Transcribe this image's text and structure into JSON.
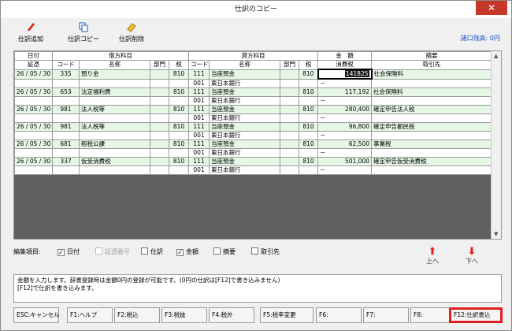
{
  "window": {
    "title": "仕訳のコピー",
    "close_glyph": "✕"
  },
  "toolbar": {
    "add_label": "仕訳追加",
    "copy_label": "仕訳コピー",
    "delete_label": "仕訳削除",
    "balance": "諸口残高: 0円"
  },
  "grid": {
    "header_top": [
      "日付",
      "借方科目",
      "貸方科目",
      "金　額",
      "摘要"
    ],
    "header_bottom": [
      "証憑",
      "コード",
      "名称",
      "部門",
      "税",
      "コード",
      "名称",
      "部門",
      "税",
      "消費税",
      "取引先"
    ],
    "rows": [
      {
        "date": "26 / 05 / 30",
        "dcode": "335",
        "dname": "預り金",
        "dtax": "810",
        "ccode": "111",
        "cname": "当座預金",
        "ctax": "810",
        "amount": "141825",
        "memo": "社会保険料",
        "ccode2": "001",
        "cname2": "東日本銀行",
        "tax2": "－"
      },
      {
        "date": "26 / 05 / 30",
        "dcode": "653",
        "dname": "法定福利費",
        "dtax": "810",
        "ccode": "111",
        "cname": "当座預金",
        "ctax": "810",
        "amount": "117,192",
        "memo": "社会保険料",
        "ccode2": "001",
        "cname2": "東日本銀行",
        "tax2": "－"
      },
      {
        "date": "26 / 05 / 30",
        "dcode": "981",
        "dname": "法人税等",
        "dtax": "810",
        "ccode": "111",
        "cname": "当座預金",
        "ctax": "810",
        "amount": "280,400",
        "memo": "確定申告法人税",
        "ccode2": "001",
        "cname2": "東日本銀行",
        "tax2": "－"
      },
      {
        "date": "26 / 05 / 30",
        "dcode": "981",
        "dname": "法人税等",
        "dtax": "810",
        "ccode": "111",
        "cname": "当座預金",
        "ctax": "810",
        "amount": "96,800",
        "memo": "確定申告都民税",
        "ccode2": "001",
        "cname2": "東日本銀行",
        "tax2": "－"
      },
      {
        "date": "26 / 05 / 30",
        "dcode": "681",
        "dname": "租税公課",
        "dtax": "810",
        "ccode": "111",
        "cname": "当座預金",
        "ctax": "810",
        "amount": "62,500",
        "memo": "事業税",
        "ccode2": "001",
        "cname2": "東日本銀行",
        "tax2": "－"
      },
      {
        "date": "26 / 05 / 30",
        "dcode": "337",
        "dname": "仮受消費税",
        "dtax": "810",
        "ccode": "111",
        "cname": "当座預金",
        "ctax": "810",
        "amount": "501,000",
        "memo": "確定申告仮受消費税",
        "ccode2": "001",
        "cname2": "東日本銀行",
        "tax2": "－"
      }
    ]
  },
  "edit_items": {
    "label": "編集項目:",
    "date": "日付",
    "voucher": "証憑番号",
    "journal": "仕訳",
    "amount": "金額",
    "memo": "摘要",
    "partner": "取引先"
  },
  "nav": {
    "up": "上へ",
    "down": "下へ"
  },
  "message": {
    "line1": "金額を入力します。辞書登録時は金額0円の登録が可能です。(0円の仕訳は[F12]で書き込みません)",
    "line2": "[F12]で仕訳を書き込みます。"
  },
  "fkeys": [
    "ESC:キャンセル",
    "F1:ヘルプ",
    "F2:税込",
    "F3:税抜",
    "F4:税外",
    "F5:税率変更",
    "F6:",
    "F7:",
    "F8:",
    "F12:仕訳書込"
  ],
  "colors": {
    "row_green": "#e6f7e6",
    "accent_red": "#e02020",
    "link_blue": "#1a4fcc"
  }
}
